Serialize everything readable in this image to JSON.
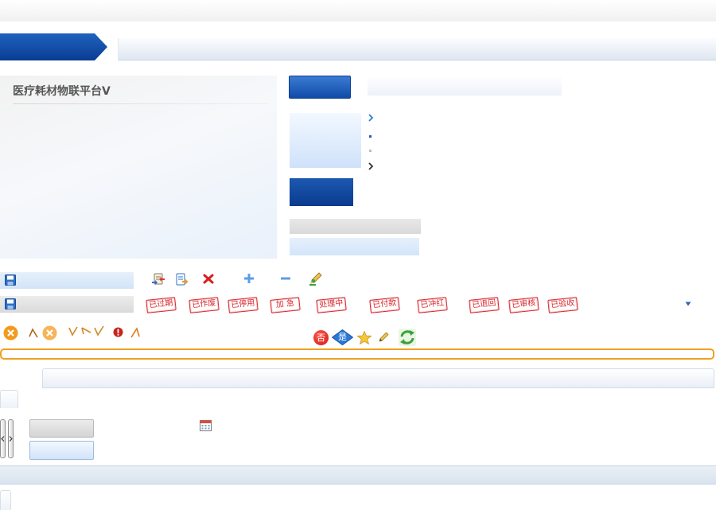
{
  "brand": {
    "title": "医疗耗材物联平台V"
  },
  "stamps": [
    "已过期",
    "已作废",
    "已停用",
    "加 急",
    "处理中",
    "已付款",
    "已冲红",
    "已退回",
    "已审核",
    "已验收"
  ],
  "badges": {
    "no": "否",
    "yes": "是"
  },
  "icons": [
    "save-icon",
    "sync-edit-icon",
    "export-icon",
    "delete-icon",
    "add-icon",
    "remove-icon",
    "edit-icon",
    "dropdown-arrow-icon",
    "cancel-icon",
    "chevron-up-icon",
    "chevron-down-icon",
    "chevron-left-icon",
    "check-icon",
    "warning-icon",
    "star-icon",
    "pencil-icon",
    "refresh-icon",
    "calendar-icon",
    "chevron-right-icon",
    "bullet-icon"
  ],
  "colors": {
    "primary_blue": "#0f4ca8",
    "stamp_red": "#d8262c",
    "accent_orange": "#f0a020",
    "light_blue": "#d3e4f8",
    "title_gray": "#565656"
  }
}
